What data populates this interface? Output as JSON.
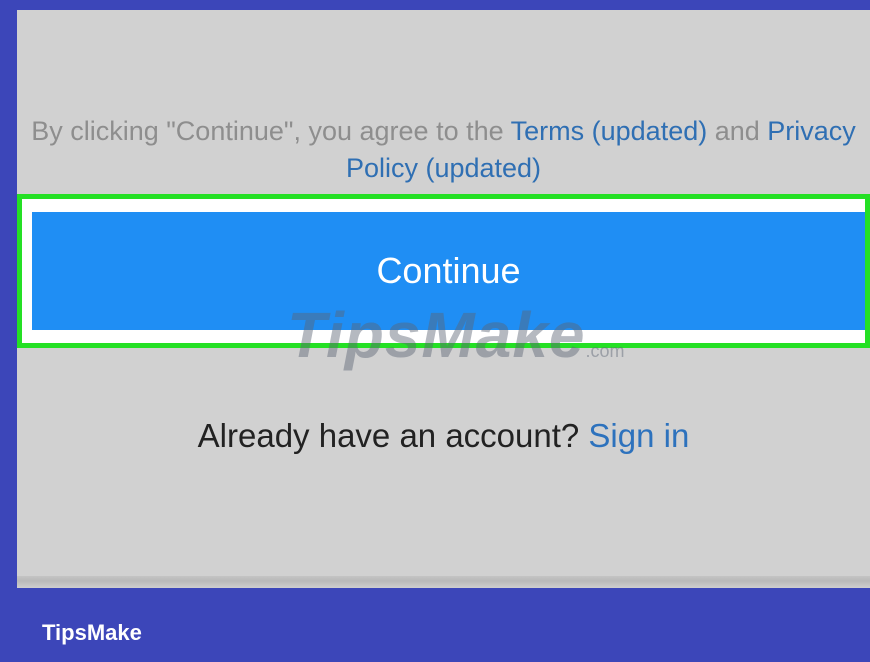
{
  "terms": {
    "prefix": "By clicking \"Continue\", you agree to the ",
    "terms_link": "Terms (updated)",
    "middle": " and ",
    "privacy_link": "Privacy Policy (updated)"
  },
  "continue_button": {
    "label": "Continue"
  },
  "signin": {
    "prompt": "Already have an account? ",
    "link": "Sign in"
  },
  "watermark": {
    "text": "TipsMake",
    "suffix": ".com"
  },
  "footer": {
    "brand": "TipsMake"
  },
  "colors": {
    "frame": "#3c46b9",
    "panel": "#d1d1d1",
    "button": "#1f8ef4",
    "highlight": "#24e024",
    "link": "#2f6fb3"
  }
}
